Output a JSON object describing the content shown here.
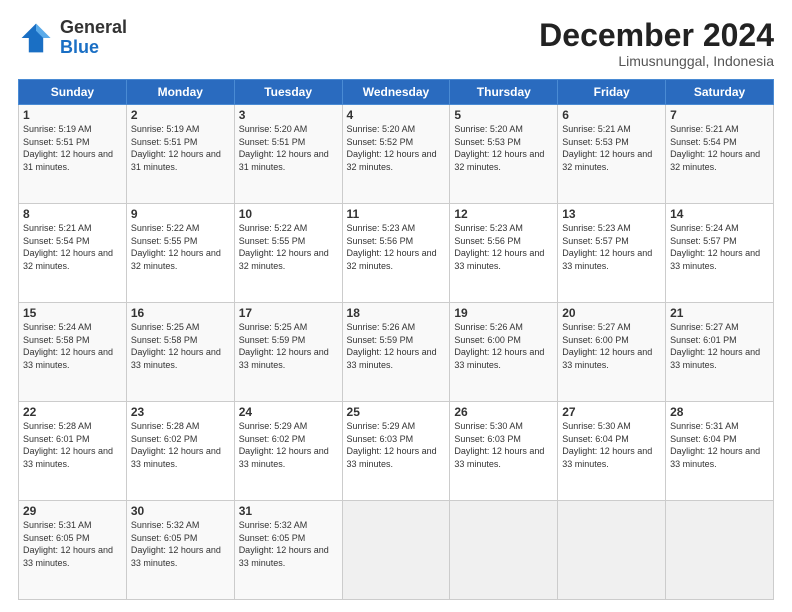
{
  "logo": {
    "general": "General",
    "blue": "Blue"
  },
  "header": {
    "month": "December 2024",
    "location": "Limusnunggal, Indonesia"
  },
  "days_of_week": [
    "Sunday",
    "Monday",
    "Tuesday",
    "Wednesday",
    "Thursday",
    "Friday",
    "Saturday"
  ],
  "weeks": [
    [
      {
        "day": "1",
        "sunrise": "5:19 AM",
        "sunset": "5:51 PM",
        "daylight": "12 hours and 31 minutes."
      },
      {
        "day": "2",
        "sunrise": "5:19 AM",
        "sunset": "5:51 PM",
        "daylight": "12 hours and 31 minutes."
      },
      {
        "day": "3",
        "sunrise": "5:20 AM",
        "sunset": "5:51 PM",
        "daylight": "12 hours and 31 minutes."
      },
      {
        "day": "4",
        "sunrise": "5:20 AM",
        "sunset": "5:52 PM",
        "daylight": "12 hours and 32 minutes."
      },
      {
        "day": "5",
        "sunrise": "5:20 AM",
        "sunset": "5:53 PM",
        "daylight": "12 hours and 32 minutes."
      },
      {
        "day": "6",
        "sunrise": "5:21 AM",
        "sunset": "5:53 PM",
        "daylight": "12 hours and 32 minutes."
      },
      {
        "day": "7",
        "sunrise": "5:21 AM",
        "sunset": "5:54 PM",
        "daylight": "12 hours and 32 minutes."
      }
    ],
    [
      {
        "day": "8",
        "sunrise": "5:21 AM",
        "sunset": "5:54 PM",
        "daylight": "12 hours and 32 minutes."
      },
      {
        "day": "9",
        "sunrise": "5:22 AM",
        "sunset": "5:55 PM",
        "daylight": "12 hours and 32 minutes."
      },
      {
        "day": "10",
        "sunrise": "5:22 AM",
        "sunset": "5:55 PM",
        "daylight": "12 hours and 32 minutes."
      },
      {
        "day": "11",
        "sunrise": "5:23 AM",
        "sunset": "5:56 PM",
        "daylight": "12 hours and 32 minutes."
      },
      {
        "day": "12",
        "sunrise": "5:23 AM",
        "sunset": "5:56 PM",
        "daylight": "12 hours and 33 minutes."
      },
      {
        "day": "13",
        "sunrise": "5:23 AM",
        "sunset": "5:57 PM",
        "daylight": "12 hours and 33 minutes."
      },
      {
        "day": "14",
        "sunrise": "5:24 AM",
        "sunset": "5:57 PM",
        "daylight": "12 hours and 33 minutes."
      }
    ],
    [
      {
        "day": "15",
        "sunrise": "5:24 AM",
        "sunset": "5:58 PM",
        "daylight": "12 hours and 33 minutes."
      },
      {
        "day": "16",
        "sunrise": "5:25 AM",
        "sunset": "5:58 PM",
        "daylight": "12 hours and 33 minutes."
      },
      {
        "day": "17",
        "sunrise": "5:25 AM",
        "sunset": "5:59 PM",
        "daylight": "12 hours and 33 minutes."
      },
      {
        "day": "18",
        "sunrise": "5:26 AM",
        "sunset": "5:59 PM",
        "daylight": "12 hours and 33 minutes."
      },
      {
        "day": "19",
        "sunrise": "5:26 AM",
        "sunset": "6:00 PM",
        "daylight": "12 hours and 33 minutes."
      },
      {
        "day": "20",
        "sunrise": "5:27 AM",
        "sunset": "6:00 PM",
        "daylight": "12 hours and 33 minutes."
      },
      {
        "day": "21",
        "sunrise": "5:27 AM",
        "sunset": "6:01 PM",
        "daylight": "12 hours and 33 minutes."
      }
    ],
    [
      {
        "day": "22",
        "sunrise": "5:28 AM",
        "sunset": "6:01 PM",
        "daylight": "12 hours and 33 minutes."
      },
      {
        "day": "23",
        "sunrise": "5:28 AM",
        "sunset": "6:02 PM",
        "daylight": "12 hours and 33 minutes."
      },
      {
        "day": "24",
        "sunrise": "5:29 AM",
        "sunset": "6:02 PM",
        "daylight": "12 hours and 33 minutes."
      },
      {
        "day": "25",
        "sunrise": "5:29 AM",
        "sunset": "6:03 PM",
        "daylight": "12 hours and 33 minutes."
      },
      {
        "day": "26",
        "sunrise": "5:30 AM",
        "sunset": "6:03 PM",
        "daylight": "12 hours and 33 minutes."
      },
      {
        "day": "27",
        "sunrise": "5:30 AM",
        "sunset": "6:04 PM",
        "daylight": "12 hours and 33 minutes."
      },
      {
        "day": "28",
        "sunrise": "5:31 AM",
        "sunset": "6:04 PM",
        "daylight": "12 hours and 33 minutes."
      }
    ],
    [
      {
        "day": "29",
        "sunrise": "5:31 AM",
        "sunset": "6:05 PM",
        "daylight": "12 hours and 33 minutes."
      },
      {
        "day": "30",
        "sunrise": "5:32 AM",
        "sunset": "6:05 PM",
        "daylight": "12 hours and 33 minutes."
      },
      {
        "day": "31",
        "sunrise": "5:32 AM",
        "sunset": "6:05 PM",
        "daylight": "12 hours and 33 minutes."
      },
      null,
      null,
      null,
      null
    ]
  ]
}
